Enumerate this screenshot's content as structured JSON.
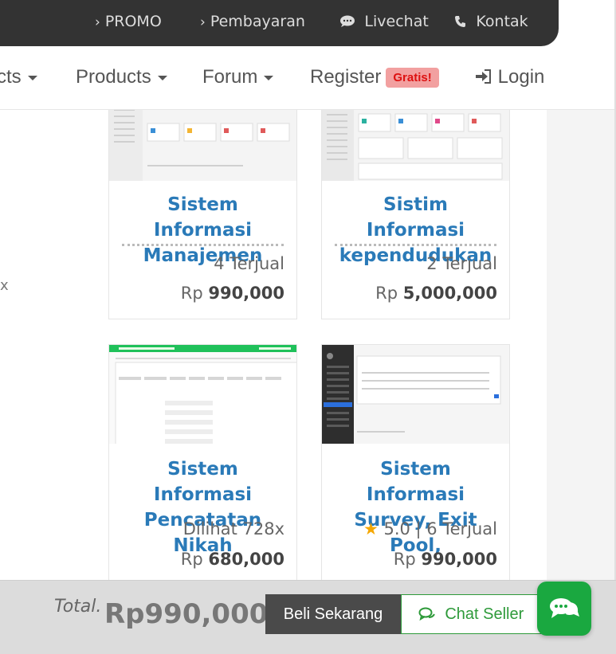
{
  "topbar": {
    "links": [
      {
        "icon": "chevron-right-icon",
        "label": "PROMO"
      },
      {
        "icon": "chevron-right-icon",
        "label": "Pembayaran"
      },
      {
        "icon": "chat-bubble-icon",
        "label": "Livechat"
      },
      {
        "icon": "phone-icon",
        "label": "Kontak"
      }
    ]
  },
  "nav": {
    "items": [
      {
        "label": "cts"
      },
      {
        "label": "Products"
      },
      {
        "label": "Forum"
      },
      {
        "label": "Register",
        "badge": "Gratis!"
      },
      {
        "label": "Login",
        "icon": "login-icon"
      }
    ]
  },
  "products": [
    {
      "title": "Sistem Informasi Manajemen",
      "meta": "4 Terjual",
      "currency": "Rp",
      "price": "990,000"
    },
    {
      "title": "Sistim Informasi kependudukan",
      "meta": "2 Terjual",
      "currency": "Rp",
      "price": "5,000,000"
    },
    {
      "title": "Sistem Informasi Pencatatan Nikah",
      "meta": "Dilihat 728x",
      "currency": "Rp",
      "price": "680,000"
    },
    {
      "title": "Sistem Informasi Survey, Exit Pool,",
      "rating": "5.0",
      "meta": "| 6 Terjual",
      "currency": "Rp",
      "price": "990,000"
    }
  ],
  "bottom": {
    "total_label": "Total.",
    "total_value": "Rp990,000",
    "buy_label": "Beli Sekarang",
    "chat_label": "Chat Seller"
  },
  "colors": {
    "accent": "#2a7ab8",
    "chat_green": "#1aa840",
    "badge_red": "#d11111",
    "star": "#f5a700"
  }
}
